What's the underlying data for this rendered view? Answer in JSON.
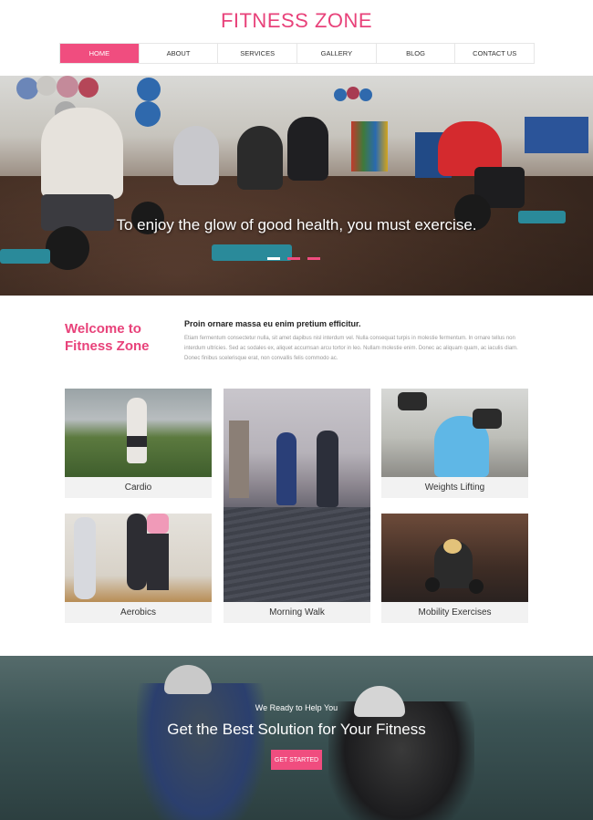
{
  "header": {
    "logo": "FITNESS ZONE",
    "nav": [
      {
        "label": "HOME",
        "active": true
      },
      {
        "label": "ABOUT"
      },
      {
        "label": "SERVICES"
      },
      {
        "label": "GALLERY"
      },
      {
        "label": "BLOG"
      },
      {
        "label": "CONTACT US"
      }
    ]
  },
  "hero": {
    "caption": "To enjoy the glow of good health, you must exercise.",
    "slides": 3,
    "active_slide": 1
  },
  "welcome": {
    "title_line1": "Welcome to",
    "title_line2": "Fitness Zone",
    "heading": "Proin ornare massa eu enim pretium efficitur.",
    "body": "Etiam fermentum consectetur nulla, sit amet dapibus nisl interdum vel. Nulla consequat turpis in molestie fermentum. In ornare tellus non interdum ultricies. Sed ac sodales ex, aliquet accumsan arcu tortor in leo. Nullam molestie enim. Donec ac aliquam quam, ac iaculis diam. Donec finibus scelerisque erat, non convallis felis commodo ac."
  },
  "services": [
    {
      "label": "Cardio"
    },
    {
      "label": "Weights Lifting"
    },
    {
      "label": "Aerobics"
    },
    {
      "label": "Mobility Exercises"
    },
    {
      "label": "Morning Walk"
    }
  ],
  "banner": {
    "subtitle": "We Ready to Help You",
    "title": "Get the Best Solution for Your Fitness",
    "button": "GET STARTED"
  },
  "colors": {
    "accent": "#f04d7f",
    "logo": "#e8427a"
  }
}
